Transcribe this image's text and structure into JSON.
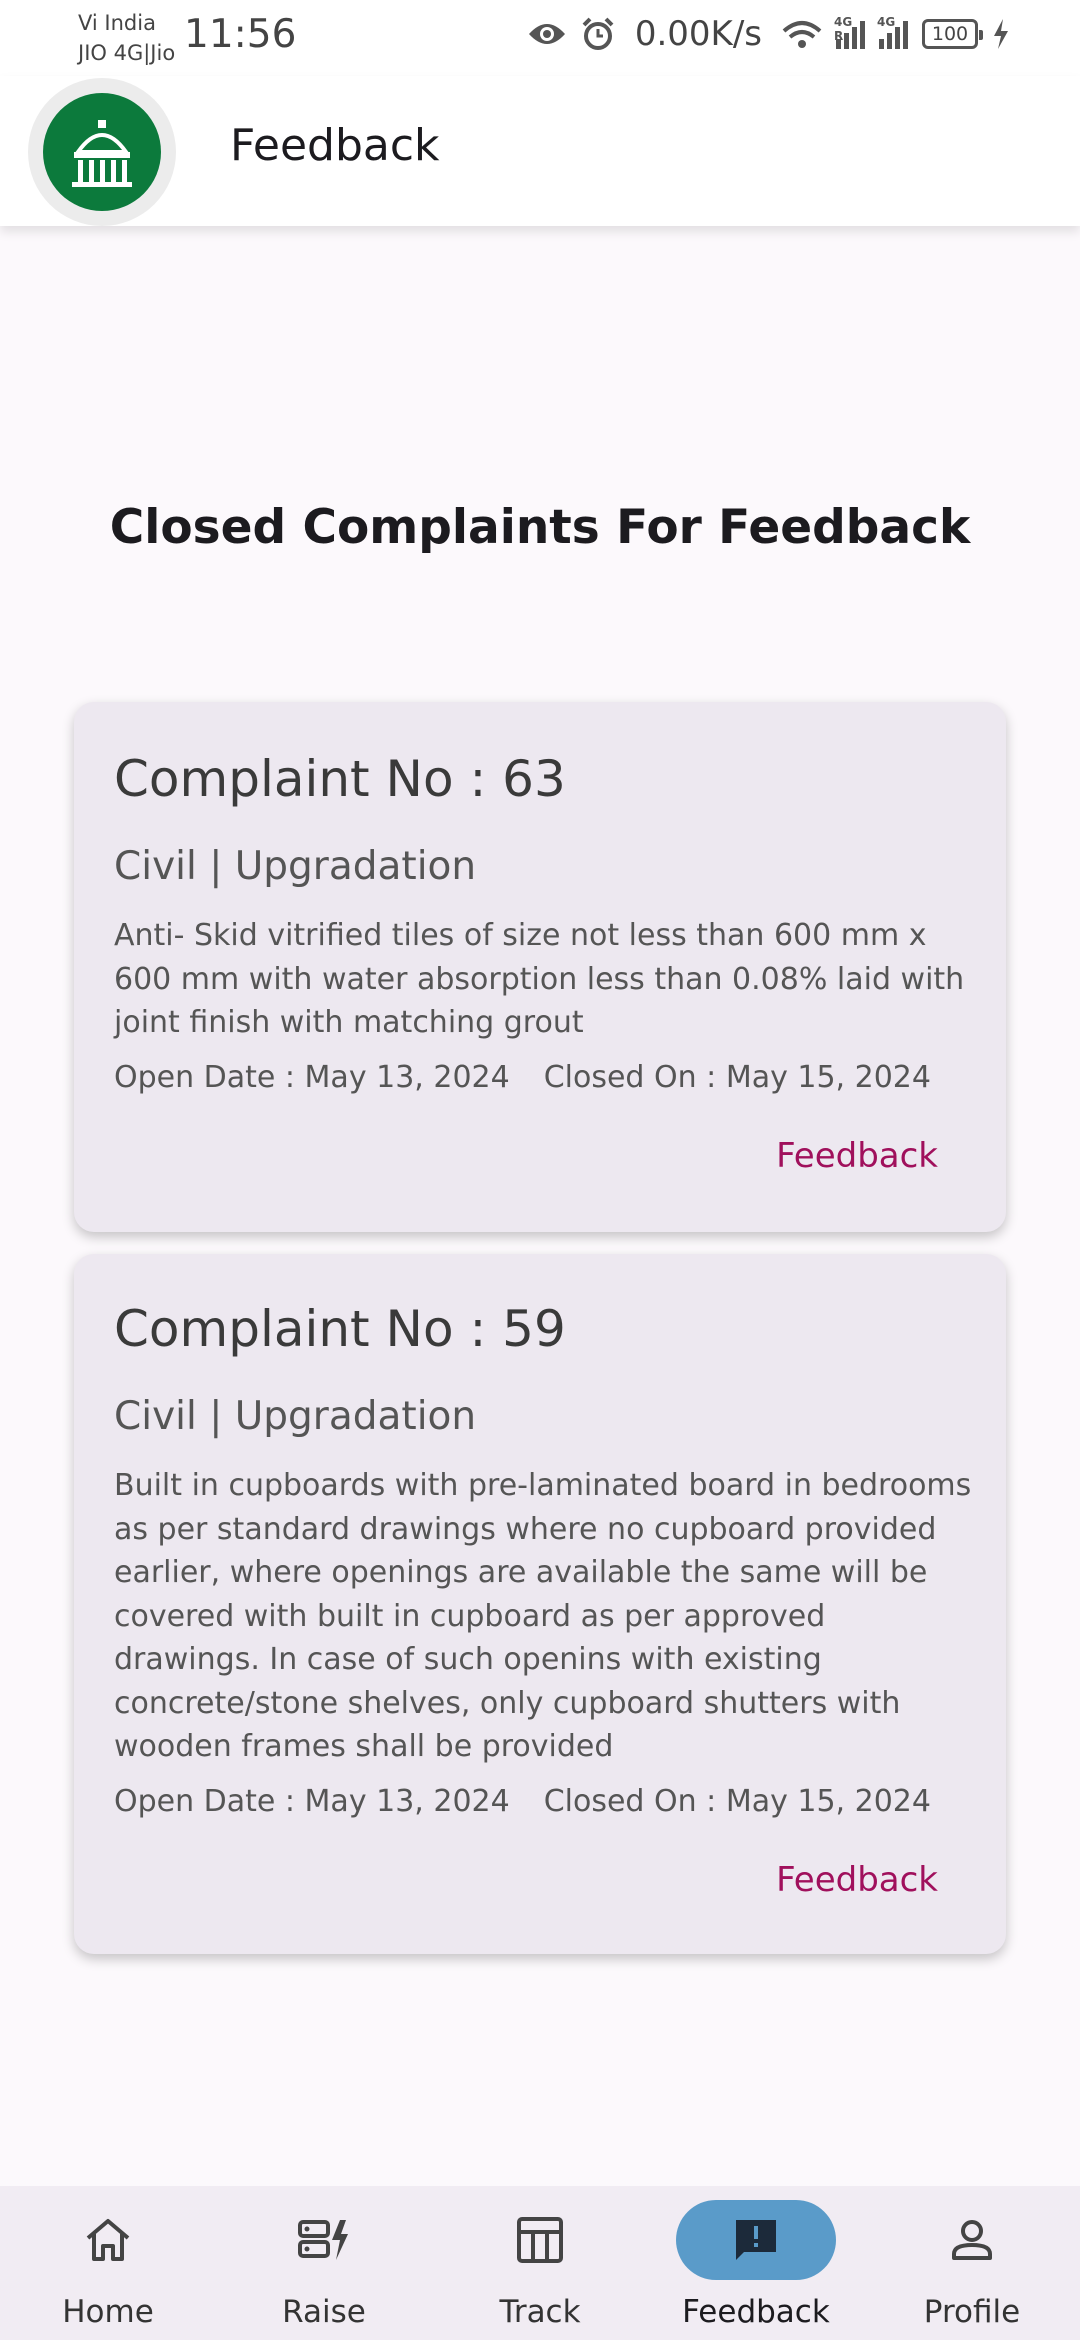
{
  "status_bar": {
    "carrier_line1": "Vi India",
    "carrier_line2": "JIO 4G|Jio",
    "time": "11:56",
    "net_speed": "0.00K/s",
    "signal1_tag": "4G R",
    "signal2_tag": "4G",
    "battery": "100",
    "icons": [
      "eye-icon",
      "alarm-icon",
      "wifi-icon",
      "signal-icon",
      "signal-icon",
      "battery-icon",
      "charging-icon"
    ]
  },
  "app_bar": {
    "title": "Feedback",
    "logo_icon": "building-emblem-icon"
  },
  "main": {
    "heading": "Closed Complaints For Feedback",
    "complaints": [
      {
        "number": "Complaint No : 63",
        "category": "Civil | Upgradation",
        "description": "Anti- Skid vitrified tiles of size not less than 600 mm x 600 mm with water absorption less than 0.08% laid with joint finish with matching grout",
        "open_date": "Open Date : May 13, 2024",
        "closed_on": "Closed On : May 15, 2024",
        "action": "Feedback"
      },
      {
        "number": "Complaint No : 59",
        "category": "Civil | Upgradation",
        "description": "Built in cupboards with pre-laminated board in bedrooms as per standard drawings where no cupboard provided earlier, where openings are available the same will be covered with built in cupboard as per approved drawings. In case of such openins with existing concrete/stone shelves, only cupboard shutters with wooden frames shall be provided",
        "open_date": "Open Date : May 13, 2024",
        "closed_on": "Closed On : May 15, 2024",
        "action": "Feedback"
      }
    ]
  },
  "bottom_nav": {
    "items": [
      {
        "label": "Home",
        "icon": "home-icon"
      },
      {
        "label": "Raise",
        "icon": "raise-icon"
      },
      {
        "label": "Track",
        "icon": "track-icon"
      },
      {
        "label": "Feedback",
        "icon": "feedback-icon",
        "active": true
      },
      {
        "label": "Profile",
        "icon": "profile-icon"
      }
    ]
  },
  "colors": {
    "accent": "#a0105c",
    "nav_active": "#5a9bc9",
    "logo_green": "#0c7a3c",
    "card_bg": "#ede8f0"
  }
}
